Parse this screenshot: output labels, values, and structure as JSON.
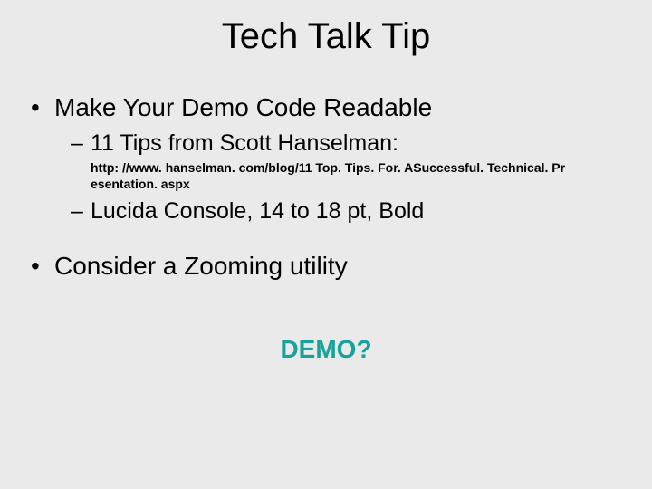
{
  "title": "Tech Talk Tip",
  "bullets": {
    "b1": "Make Your Demo Code Readable",
    "b1_sub1": "11 Tips from Scott Hanselman:",
    "b1_sub1_url": "http: //www. hanselman. com/blog/11 Top. Tips. For. ASuccessful. Technical. Pr esentation. aspx",
    "b1_sub2": "Lucida Console, 14 to 18 pt, Bold",
    "b2": "Consider a Zooming utility"
  },
  "demo": "DEMO?"
}
